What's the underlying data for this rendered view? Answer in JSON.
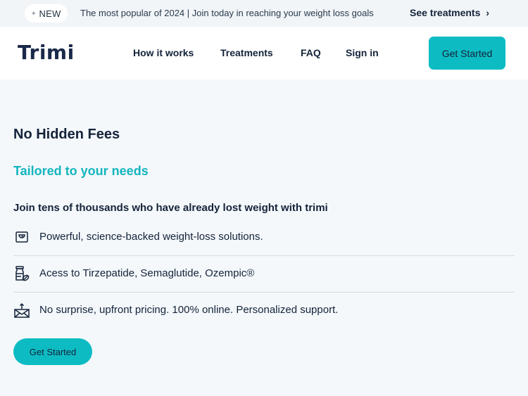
{
  "announcement": {
    "badge": "NEW",
    "text": "The most popular of 2024 | Join today in reaching your weight loss goals",
    "link_label": "See treatments",
    "link_chevron": "›"
  },
  "nav": {
    "logo": "Trimi",
    "links": [
      "How it works",
      "Treatments",
      "FAQ",
      "Sign in"
    ],
    "cta_label": "Get Started"
  },
  "hero": {
    "heading": "No Hidden Fees",
    "subheading": "Tailored to your needs",
    "intro": "Join tens of thousands who have already lost weight with trimi",
    "features": [
      {
        "icon": "scale-icon",
        "text": "Powerful, science-backed weight-loss solutions."
      },
      {
        "icon": "pill-bottle-icon",
        "text": "Acess to Tirzepatide, Semaglutide, Ozempic®"
      },
      {
        "icon": "envelope-icon",
        "text": "No surprise, upfront pricing. 100% online. Personalized support."
      }
    ],
    "cta_label": "Get Started"
  },
  "colors": {
    "accent": "#0dbcc3",
    "accent_text": "#13b5bd",
    "navy": "#14233a",
    "page_bg": "#f4f8fb"
  }
}
